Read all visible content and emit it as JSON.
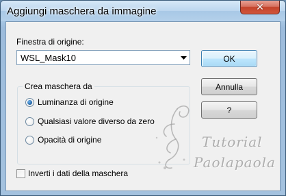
{
  "window": {
    "title": "Aggiungi maschera da immagine",
    "close_glyph": "✕"
  },
  "source": {
    "label": "Finestra di origine:",
    "selected": "WSL_Mask10"
  },
  "buttons": {
    "ok": "OK",
    "cancel": "Annulla",
    "help": "?"
  },
  "create_group": {
    "legend": "Crea maschera da",
    "options": [
      {
        "label": "Luminanza di origine",
        "checked": true
      },
      {
        "label": "Qualsiasi valore diverso da zero",
        "checked": false
      },
      {
        "label": "Opacità di origine",
        "checked": false
      }
    ]
  },
  "invert": {
    "label": "Inverti i dati della maschera",
    "checked": false
  },
  "watermark": {
    "line1": "Tutorial",
    "line2": "Paolapaola"
  },
  "colors": {
    "close_button": "#c4432b",
    "default_button_border": "#3c7fb1",
    "radio_selected": "#1f5f9f"
  }
}
